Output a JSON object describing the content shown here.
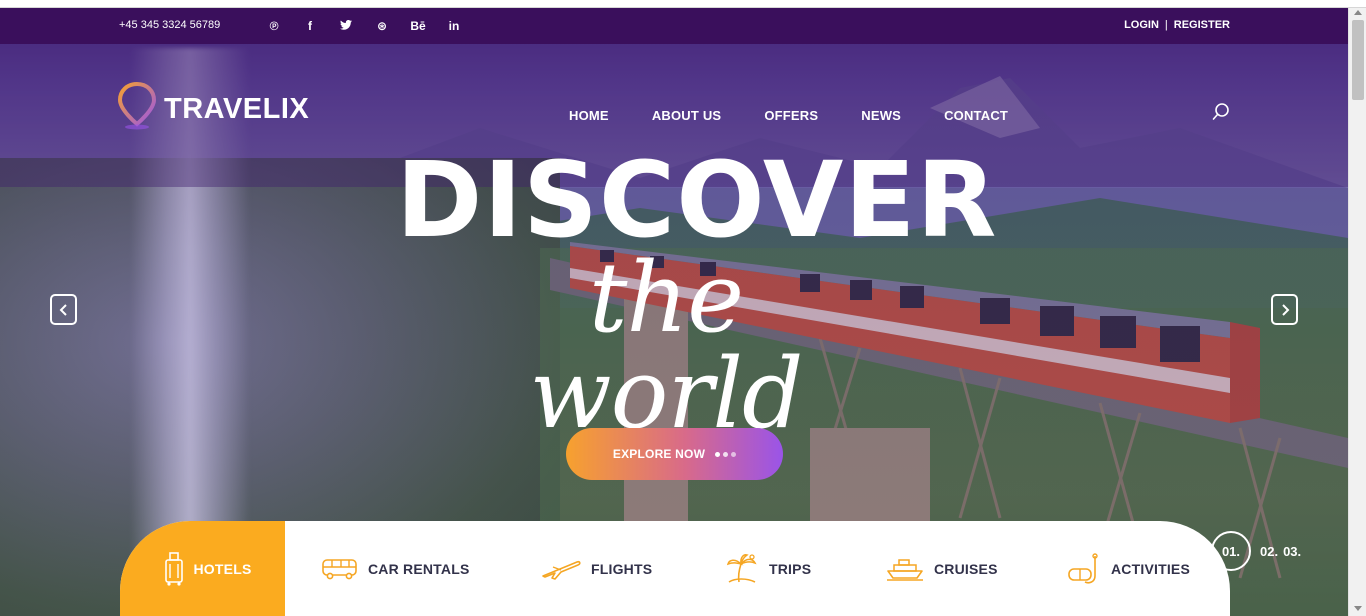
{
  "topbar": {
    "phone": "+45 345 3324 56789",
    "social": [
      {
        "icon": "pinterest-icon",
        "glyph": "℗"
      },
      {
        "icon": "facebook-icon",
        "glyph": "f"
      },
      {
        "icon": "twitter-icon",
        "glyph": "🐦"
      },
      {
        "icon": "dribbble-icon",
        "glyph": "⊛"
      },
      {
        "icon": "behance-icon",
        "glyph": "Bē"
      },
      {
        "icon": "linkedin-icon",
        "glyph": "in"
      }
    ],
    "login": "LOGIN",
    "separator": "|",
    "register": "REGISTER"
  },
  "header": {
    "logo_text": "TRAVELIX",
    "nav": [
      "HOME",
      "ABOUT US",
      "OFFERS",
      "NEWS",
      "CONTACT"
    ]
  },
  "hero": {
    "headline": "DISCOVER",
    "subheadline": "the world",
    "cta_label": "EXPLORE NOW"
  },
  "tabs": [
    {
      "label": "HOTELS",
      "icon": "luggage-icon",
      "active": true
    },
    {
      "label": "CAR RENTALS",
      "icon": "bus-icon",
      "active": false
    },
    {
      "label": "FLIGHTS",
      "icon": "airplane-icon",
      "active": false
    },
    {
      "label": "TRIPS",
      "icon": "palm-island-icon",
      "active": false
    },
    {
      "label": "CRUISES",
      "icon": "ship-icon",
      "active": false
    },
    {
      "label": "ACTIVITIES",
      "icon": "snorkel-icon",
      "active": false
    }
  ],
  "pager": [
    "01.",
    "02.",
    "03."
  ],
  "colors": {
    "topbar": "#3a0f5c",
    "accent_orange": "#fbab1f",
    "cta_gradient_start": "#f7a12e",
    "cta_gradient_end": "#9a54e8",
    "tab_icon": "#f5a623",
    "tab_text": "#32324a"
  }
}
